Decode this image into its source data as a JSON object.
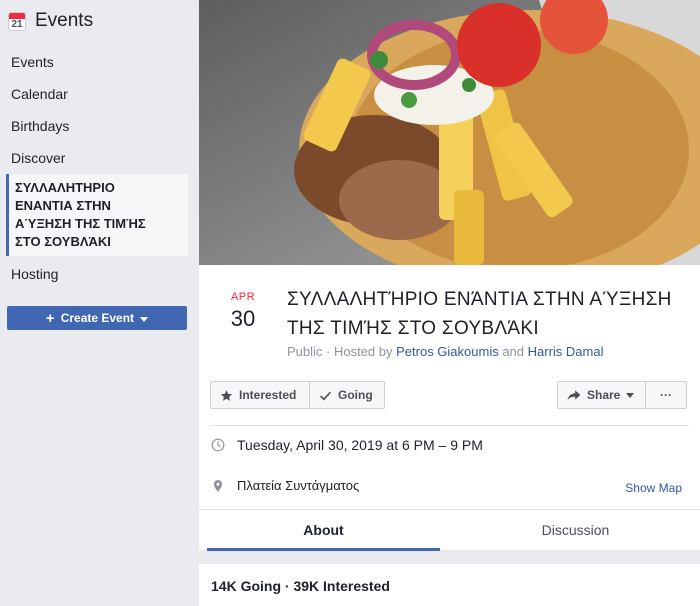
{
  "sidebar": {
    "calendar_icon_day": "21",
    "title": "Events",
    "items": [
      {
        "label": "Events"
      },
      {
        "label": "Calendar"
      },
      {
        "label": "Birthdays"
      },
      {
        "label": "Discover"
      }
    ],
    "active_event_lines": [
      "ΣΥΛΛΑΛΗΤΗΡΙΟ",
      "ΕΝΑΝΤΙΑ ΣΤΗΝ",
      "ΑΎΞΗΣΗ ΤΗΣ ΤΙΜΉΣ",
      "ΣΤΟ ΣΟΥΒΛΆΚΙ"
    ],
    "hosting_label": "Hosting",
    "create_button": "Create Event"
  },
  "event": {
    "month": "APR",
    "day": "30",
    "title": "ΣΥΛΛΑΛΗΤΉΡΙΟ ΕΝΆΝΤΙΑ ΣΤΗΝ ΑΎΞΗΣΗ ΤΗΣ ΤΙΜΉΣ ΣΤΟ ΣΟΥΒΛΆΚΙ",
    "privacy": "Public",
    "hosted_by_prefix": " · Hosted by ",
    "host1": "Petros Giakoumis",
    "and": " and ",
    "host2": "Harris Damal",
    "interested_label": "Interested",
    "going_label": "Going",
    "share_label": "Share",
    "more_label": "···",
    "datetime": "Tuesday, April 30, 2019 at 6 PM – 9 PM",
    "location": "Πλατεία Συντάγματος",
    "show_map": "Show Map",
    "tab_about": "About",
    "tab_discussion": "Discussion",
    "stats": "14K Going · 39K Interested"
  },
  "colors": {
    "accent": "#4267b2",
    "link": "#365899",
    "date_month": "#f02849"
  }
}
